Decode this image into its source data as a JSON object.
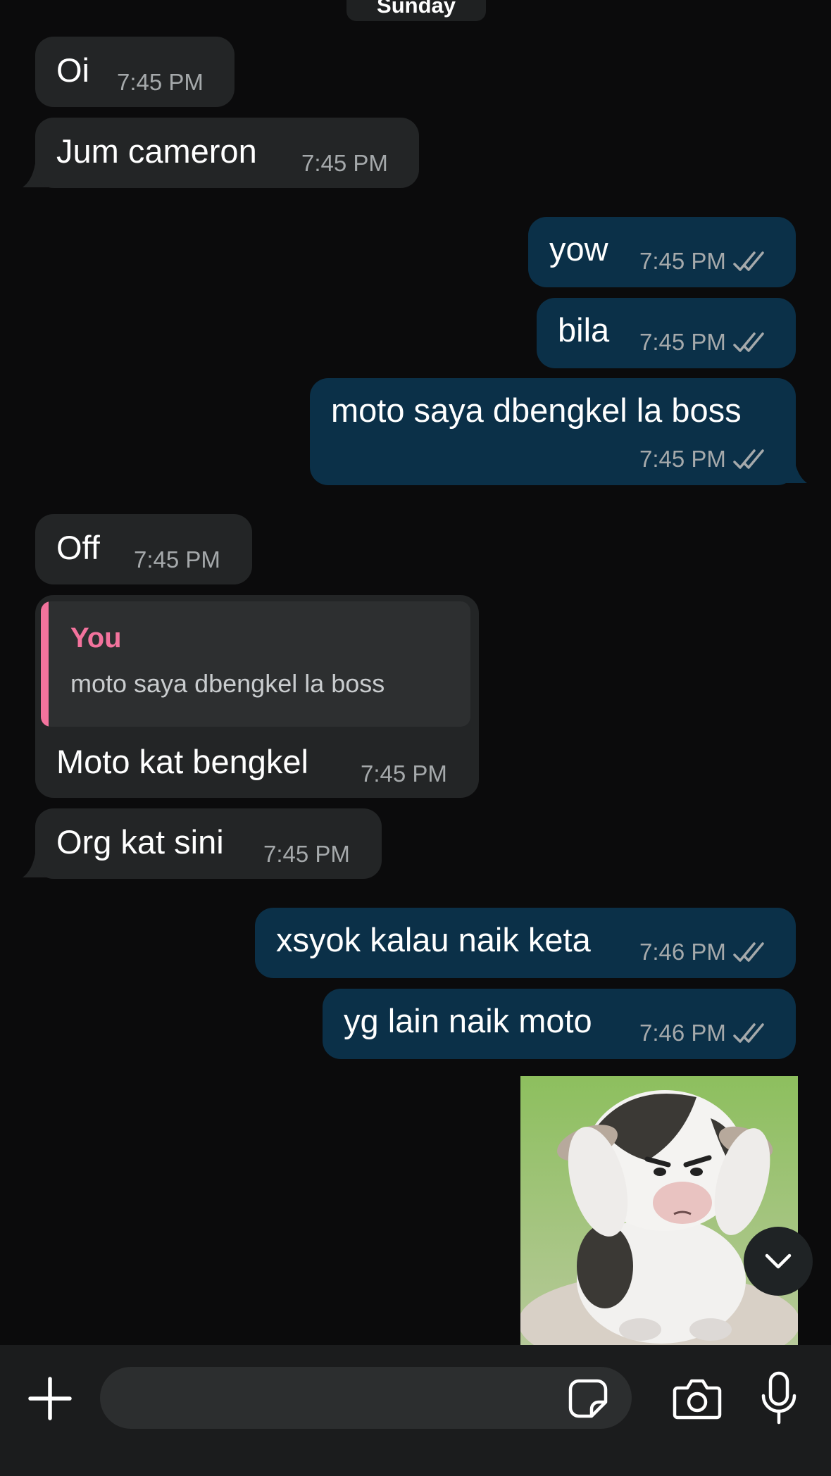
{
  "chat": {
    "day_separator": "Sunday",
    "messages": [
      {
        "direction": "in",
        "text": "Oi",
        "time": "7:45 PM"
      },
      {
        "direction": "in",
        "text": "Jum cameron",
        "time": "7:45 PM"
      },
      {
        "direction": "out",
        "text": "yow",
        "time": "7:45 PM",
        "status": "read"
      },
      {
        "direction": "out",
        "text": "bila",
        "time": "7:45 PM",
        "status": "read"
      },
      {
        "direction": "out",
        "text": "moto saya dbengkel la boss",
        "time": "7:45 PM",
        "status": "read"
      },
      {
        "direction": "in",
        "text": "Off",
        "time": "7:45 PM"
      },
      {
        "direction": "in",
        "text": "Moto kat bengkel",
        "time": "7:45 PM",
        "reply_to": {
          "author": "You",
          "text": "moto saya dbengkel la boss"
        }
      },
      {
        "direction": "in",
        "text": "Org kat sini",
        "time": "7:45 PM"
      },
      {
        "direction": "out",
        "text": "xsyok kalau naik keta",
        "time": "7:46 PM",
        "status": "read"
      },
      {
        "direction": "out",
        "text": "yg lain naik moto",
        "time": "7:46 PM",
        "status": "read"
      },
      {
        "direction": "out",
        "type": "sticker",
        "sticker": "frustrated-cow-sticker"
      }
    ]
  },
  "composer": {
    "placeholder": "",
    "icons": [
      "plus-icon",
      "sticker-icon",
      "camera-icon",
      "microphone-icon"
    ]
  },
  "colors": {
    "background": "#0b0b0c",
    "incoming_bubble": "#232526",
    "outgoing_bubble": "#0b3048",
    "reply_accent": "#f3739d",
    "meta_text": "#a5a9ab"
  }
}
